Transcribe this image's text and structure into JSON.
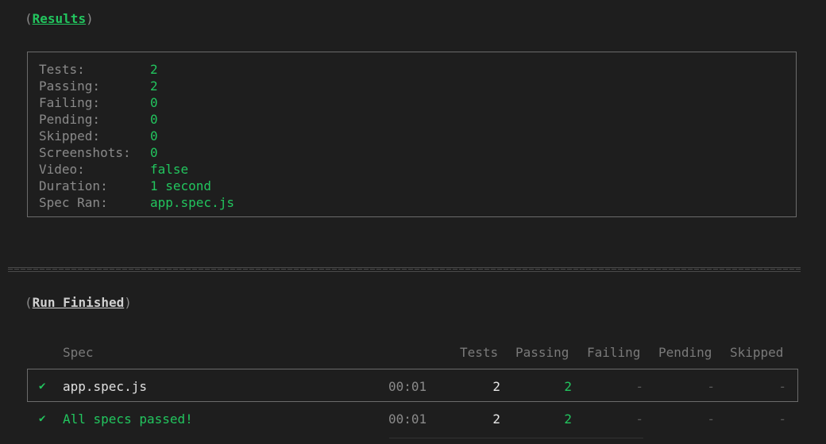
{
  "results_header": {
    "open": "(",
    "title": "Results",
    "close": ")"
  },
  "stats": [
    {
      "label": "Tests:",
      "value": "2"
    },
    {
      "label": "Passing:",
      "value": "2"
    },
    {
      "label": "Failing:",
      "value": "0"
    },
    {
      "label": "Pending:",
      "value": "0"
    },
    {
      "label": "Skipped:",
      "value": "0"
    },
    {
      "label": "Screenshots:",
      "value": "0"
    },
    {
      "label": "Video:",
      "value": "false"
    },
    {
      "label": "Duration:",
      "value": "1 second"
    },
    {
      "label": "Spec Ran:",
      "value": "app.spec.js"
    }
  ],
  "run_header": {
    "open": "(",
    "title": "Run Finished",
    "close": ")"
  },
  "table": {
    "headers": {
      "spec": "Spec",
      "tests": "Tests",
      "passing": "Passing",
      "failing": "Failing",
      "pending": "Pending",
      "skipped": "Skipped"
    },
    "rows": [
      {
        "check": "✔",
        "name": "app.spec.js",
        "time": "00:01",
        "tests": "2",
        "passing": "2",
        "failing": "-",
        "pending": "-",
        "skipped": "-"
      }
    ],
    "summary": {
      "check": "✔",
      "name": "All specs passed!",
      "time": "00:01",
      "tests": "2",
      "passing": "2",
      "failing": "-",
      "pending": "-",
      "skipped": "-"
    }
  },
  "colors": {
    "background": "#1e1e1e",
    "accent_green": "#22c55e",
    "muted_text": "#8a8a8a",
    "border": "#6b6b6b"
  }
}
